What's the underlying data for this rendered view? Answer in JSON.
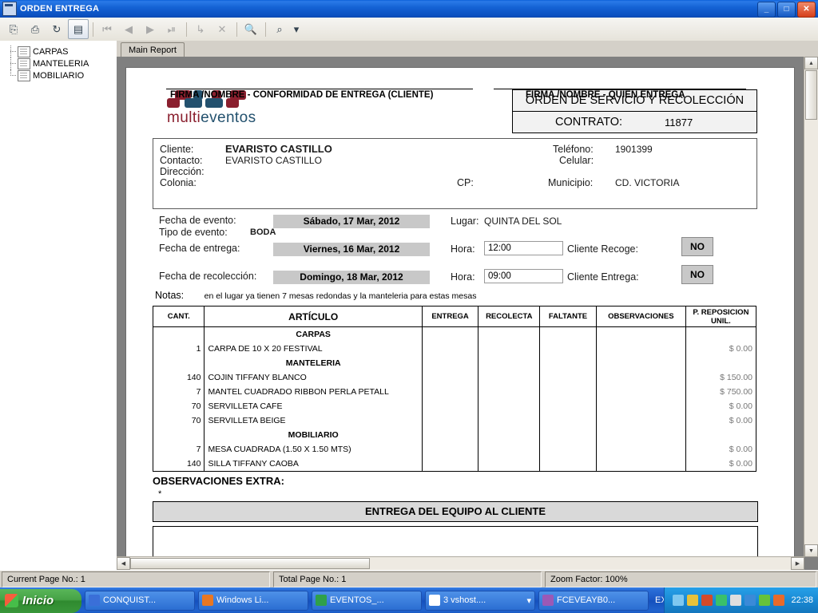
{
  "window": {
    "title": "ORDEN ENTREGA",
    "icon": "report-window-icon",
    "minimize": "_",
    "maximize": "□",
    "close": "✕"
  },
  "toolbar": {
    "buttons": [
      {
        "name": "export-report",
        "glyph": "⎗"
      },
      {
        "name": "print-report",
        "glyph": "⎙"
      },
      {
        "name": "refresh-report",
        "glyph": "↻"
      },
      {
        "name": "toggle-group-tree",
        "glyph": "▤"
      },
      {
        "name": "first-page",
        "glyph": "⏮"
      },
      {
        "name": "previous-page",
        "glyph": "◀"
      },
      {
        "name": "next-page",
        "glyph": "▶"
      },
      {
        "name": "last-page",
        "glyph": "⏭"
      },
      {
        "name": "go-to-page",
        "glyph": "↳"
      },
      {
        "name": "stop-loading",
        "glyph": "✕"
      },
      {
        "name": "search-text",
        "glyph": "🔍"
      },
      {
        "name": "zoom-control",
        "glyph": "⌕"
      },
      {
        "name": "zoom-dropdown",
        "glyph": "▾"
      }
    ]
  },
  "tree": {
    "items": [
      {
        "label": "CARPAS",
        "icon": "report-node-icon"
      },
      {
        "label": "MANTELERIA",
        "icon": "report-node-icon"
      },
      {
        "label": "MOBILIARIO",
        "icon": "report-node-icon"
      }
    ]
  },
  "tabs": {
    "main_report": "Main Report"
  },
  "report": {
    "logo": {
      "text_primary": "multi",
      "text_secondary": "eventos",
      "color_primary": "#8a1f2e",
      "color_secondary": "#23516e"
    },
    "header": {
      "title": "ORDEN DE SERVICIO Y RECOLECCIÓN",
      "contract_label": "CONTRATO:",
      "contract_value": "11877"
    },
    "client": {
      "cliente_label": "Cliente:",
      "cliente_value": "EVARISTO CASTILLO",
      "contacto_label": "Contacto:",
      "contacto_value": "EVARISTO CASTILLO",
      "direccion_label": "Dirección:",
      "direccion_value": "",
      "colonia_label": "Colonia:",
      "colonia_value": "",
      "telefono_label": "Teléfono:",
      "telefono_value": "1901399",
      "celular_label": "Celular:",
      "celular_value": "",
      "cp_label": "CP:",
      "cp_value": "",
      "municipio_label": "Municipio:",
      "municipio_value": "CD. VICTORIA",
      "fecha_evento_label": "Fecha de evento:",
      "fecha_evento_value": "Sábado, 17 Mar, 2012",
      "lugar_label": "Lugar:",
      "lugar_value": "QUINTA DEL SOL",
      "tipo_evento_label": "Tipo de evento:",
      "tipo_evento_value": "BODA",
      "fecha_entrega_label": "Fecha de entrega:",
      "fecha_entrega_value": "Viernes, 16 Mar, 2012",
      "hora_entrega_label": "Hora:",
      "hora_entrega_value": "12:00",
      "cliente_recoge_label": "Cliente Recoge:",
      "cliente_recoge_value": "NO",
      "fecha_recoleccion_label": "Fecha de recolección:",
      "fecha_recoleccion_value": "Domingo, 18 Mar, 2012",
      "hora_recoleccion_label": "Hora:",
      "hora_recoleccion_value": "09:00",
      "cliente_entrega_label": "Cliente Entrega:",
      "cliente_entrega_value": "NO"
    },
    "notes": {
      "label": "Notas:",
      "value": "en el lugar ya tienen 7 mesas redondas y la manteleria para estas mesas"
    },
    "table": {
      "columns": [
        "CANT.",
        "ARTÍCULO",
        "ENTREGA",
        "RECOLECTA",
        "FALTANTE",
        "OBSERVACIONES",
        "P. REPOSICION UNIL."
      ],
      "rows": [
        {
          "type": "section",
          "label": "CARPAS"
        },
        {
          "type": "item",
          "cant": "1",
          "articulo": "CARPA DE 10 X 20 FESTIVAL",
          "entrega": "",
          "recolecta": "",
          "faltante": "",
          "observaciones": "",
          "precio": "$        0.00"
        },
        {
          "type": "section",
          "label": "MANTELERIA"
        },
        {
          "type": "item",
          "cant": "140",
          "articulo": "COJIN TIFFANY BLANCO",
          "entrega": "",
          "recolecta": "",
          "faltante": "",
          "observaciones": "",
          "precio": "$      150.00"
        },
        {
          "type": "item",
          "cant": "7",
          "articulo": "MANTEL CUADRADO RIBBON PERLA PETALL",
          "entrega": "",
          "recolecta": "",
          "faltante": "",
          "observaciones": "",
          "precio": "$      750.00"
        },
        {
          "type": "item",
          "cant": "70",
          "articulo": "SERVILLETA CAFE",
          "entrega": "",
          "recolecta": "",
          "faltante": "",
          "observaciones": "",
          "precio": "$        0.00"
        },
        {
          "type": "item",
          "cant": "70",
          "articulo": "SERVILLETA BEIGE",
          "entrega": "",
          "recolecta": "",
          "faltante": "",
          "observaciones": "",
          "precio": "$        0.00"
        },
        {
          "type": "section",
          "label": "MOBILIARIO"
        },
        {
          "type": "item",
          "cant": "7",
          "articulo": "MESA CUADRADA (1.50 X 1.50 MTS)",
          "entrega": "",
          "recolecta": "",
          "faltante": "",
          "observaciones": "",
          "precio": "$        0.00"
        },
        {
          "type": "item",
          "cant": "140",
          "articulo": "SILLA TIFFANY CAOBA",
          "entrega": "",
          "recolecta": "",
          "faltante": "",
          "observaciones": "",
          "precio": "$        0.00"
        }
      ]
    },
    "observaciones_extra_label": "OBSERVACIONES EXTRA:",
    "observaciones_extra_value": "*",
    "entrega_banner": "ENTREGA DEL EQUIPO AL CLIENTE",
    "firma_cliente": "FIRMA /NOMBRE - CONFORMIDAD DE ENTREGA  (CLIENTE)",
    "firma_entrega": "FIRMA /NOMBRE - QUIEN ENTREGA"
  },
  "status": {
    "current_page": "Current Page No.: 1",
    "total_page": "Total Page No.: 1",
    "zoom_factor": "Zoom Factor: 100%"
  },
  "taskbar": {
    "start_label": "Inicio",
    "items": [
      {
        "label": "CONQUIST...",
        "color": "#3a6fd8"
      },
      {
        "label": "Windows Li...",
        "color": "#e87722"
      },
      {
        "label": "EVENTOS_...",
        "color": "#2fa04a"
      },
      {
        "label": "3 vshost....",
        "color": "#ffffff"
      },
      {
        "label": "FCEVEAYB0...",
        "color": "#9b59b6"
      },
      {
        "label": "EXES MAS UTILIZADOS",
        "color": "#1a56c4"
      }
    ],
    "clock": "22:38",
    "tray_icons": [
      "shield-icon",
      "network-icon",
      "volume-icon",
      "antivirus-icon",
      "update-icon",
      "battery-icon",
      "messenger-icon",
      "printer-icon"
    ]
  }
}
